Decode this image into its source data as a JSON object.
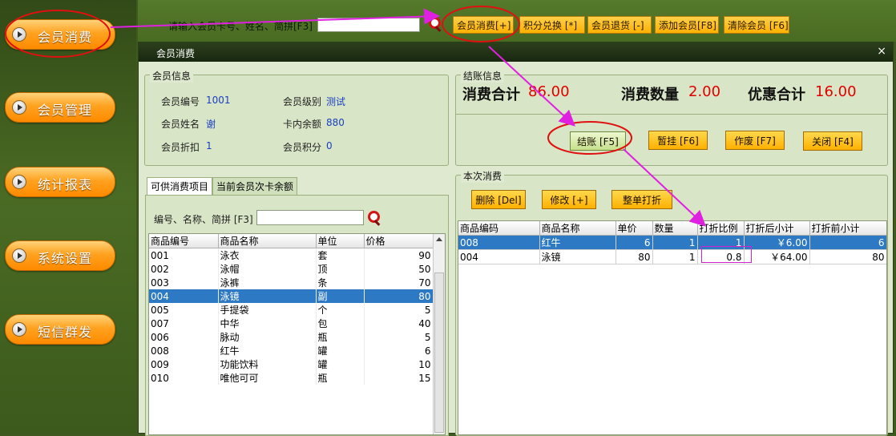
{
  "sidebar": {
    "items": [
      {
        "label": "会员消费"
      },
      {
        "label": "会员管理"
      },
      {
        "label": "统计报表"
      },
      {
        "label": "系统设置"
      },
      {
        "label": "短信群发"
      }
    ]
  },
  "topbar": {
    "search_label": "请输入会员卡号、姓名、简拼[F3]",
    "search_value": "",
    "buttons": [
      {
        "label": "会员消费[+]"
      },
      {
        "label": "积分兑换 [*]"
      },
      {
        "label": "会员退货 [-]"
      },
      {
        "label": "添加会员[F8]"
      },
      {
        "label": "清除会员 [F6]"
      }
    ]
  },
  "dialog": {
    "title": "会员消费",
    "close": "×",
    "member_info": {
      "legend": "会员信息",
      "fields": [
        {
          "label": "会员编号",
          "value": "1001"
        },
        {
          "label": "会员级别",
          "value": "测试"
        },
        {
          "label": "会员姓名",
          "value": "谢"
        },
        {
          "label": "卡内余额",
          "value": "880"
        },
        {
          "label": "会员折扣",
          "value": "1"
        },
        {
          "label": "会员积分",
          "value": "0"
        }
      ]
    },
    "checkout": {
      "legend": "结账信息",
      "total_label": "消费合计",
      "total_value": "86.00",
      "qty_label": "消费数量",
      "qty_value": "2.00",
      "discount_label": "优惠合计",
      "discount_value": "16.00",
      "buttons": [
        {
          "label": "结账 [F5]"
        },
        {
          "label": "暂挂 [F6]"
        },
        {
          "label": "作废 [F7]"
        },
        {
          "label": "关闭 [F4]"
        }
      ]
    },
    "tabs": [
      {
        "label": "可供消费项目"
      },
      {
        "label": "当前会员次卡余额"
      }
    ],
    "product_search": {
      "label": "编号、名称、简拼 [F3]",
      "value": ""
    },
    "products": {
      "columns": [
        "商品编号",
        "商品名称",
        "单位",
        "价格"
      ],
      "rows": [
        [
          "001",
          "泳衣",
          "套",
          "90"
        ],
        [
          "002",
          "泳帽",
          "顶",
          "50"
        ],
        [
          "003",
          "泳裤",
          "条",
          "70"
        ],
        [
          "004",
          "泳镜",
          "副",
          "80"
        ],
        [
          "005",
          "手提袋",
          "个",
          "5"
        ],
        [
          "007",
          "中华",
          "包",
          "40"
        ],
        [
          "006",
          "脉动",
          "瓶",
          "5"
        ],
        [
          "008",
          "红牛",
          "罐",
          "6"
        ],
        [
          "009",
          "功能饮料",
          "罐",
          "10"
        ],
        [
          "010",
          "唯他可可",
          "瓶",
          "15"
        ]
      ],
      "selected_index": 3
    },
    "current": {
      "legend": "本次消费",
      "buttons": [
        {
          "label": "删除 [Del]"
        },
        {
          "label": "修改 [+]"
        },
        {
          "label": "整单打折"
        }
      ],
      "columns": [
        "商品编码",
        "商品名称",
        "单价",
        "数量",
        "打折比例",
        "打折后小计",
        "打折前小计"
      ],
      "rows": [
        [
          "008",
          "红牛",
          "6",
          "1",
          "1",
          "￥6.00",
          "6"
        ],
        [
          "004",
          "泳镜",
          "80",
          "1",
          "0.8",
          "￥64.00",
          "80"
        ]
      ],
      "selected_index": 0
    }
  },
  "colors": {
    "accent_orange": "#ffa21f",
    "annotation_magenta": "#e020e0",
    "annotation_red": "#e01010",
    "selection_blue": "#2e79c4",
    "value_blue": "#1a3ec2",
    "value_red": "#e00000"
  }
}
